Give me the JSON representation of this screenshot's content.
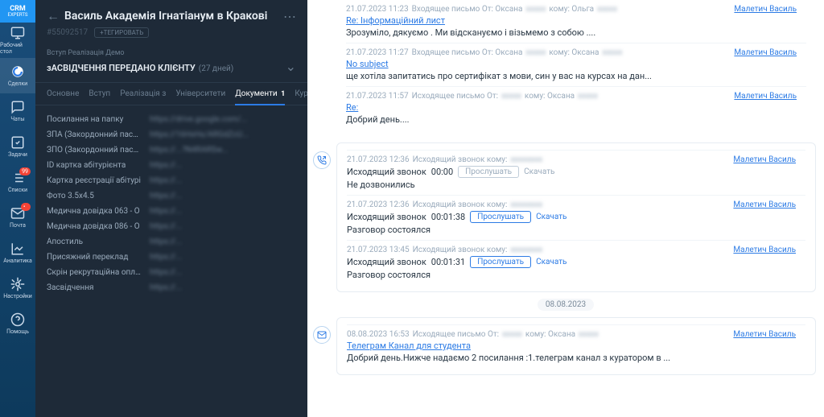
{
  "app": {
    "logo_line1": "CRM",
    "logo_line2": "EXPERTS"
  },
  "nav": [
    {
      "icon": "desktop",
      "label": "Рабочий стол"
    },
    {
      "icon": "swirl",
      "label": "Сделки",
      "active": true
    },
    {
      "icon": "chat",
      "label": "Чаты"
    },
    {
      "icon": "check",
      "label": "Задачи"
    },
    {
      "icon": "list",
      "label": "Списки",
      "badge": "99"
    },
    {
      "icon": "mail",
      "label": "Почта",
      "badge": "•"
    },
    {
      "icon": "analytics",
      "label": "Аналитика"
    },
    {
      "icon": "gear",
      "label": "Настройки"
    },
    {
      "icon": "help",
      "label": "Помощь"
    }
  ],
  "deal": {
    "title": "Василь Академія Ігнатіанум в Кракові",
    "id": "#55092517",
    "tag_btn": "+ТЕГИРОВАТЬ",
    "stage_pre": "Вступ Реалізація Демо",
    "stage_name": "зАСВІДЧЕННЯ ПЕРЕДАНО КЛІЄНТУ",
    "stage_days": "(27 дней)"
  },
  "tabs": [
    {
      "label": "Основне"
    },
    {
      "label": "Вступ"
    },
    {
      "label": "Реалізація з"
    },
    {
      "label": "Університети"
    },
    {
      "label": "Документи",
      "count": "1",
      "active": true
    },
    {
      "label": "Кур"
    }
  ],
  "docs": [
    {
      "label": "Посилання на папку",
      "value": "https://drive.google.com/..."
    },
    {
      "label": "ЗПА (Закордонний паспо",
      "value": "https://16HxHs/ARGdZcU..."
    },
    {
      "label": "ЗПО (Закордонний паспо",
      "value": "https://...?N4RARSw..."
    },
    {
      "label": "ID картка абітурієнта",
      "value": "https://..."
    },
    {
      "label": "Картка реєстрації абітурі",
      "value": "https://..."
    },
    {
      "label": "Фото 3.5х4.5",
      "value": "https://..."
    },
    {
      "label": "Медична довідка 063 - О",
      "value": "https://..."
    },
    {
      "label": "Медична довідка 086 - О",
      "value": "https://..."
    },
    {
      "label": "Апостиль",
      "value": "https://..."
    },
    {
      "label": "Присяжний переклад",
      "value": "https://..."
    },
    {
      "label": "Скрін рекрутаційна оплат",
      "value": "https://..."
    },
    {
      "label": "Засвідчення",
      "value": "https://..."
    }
  ],
  "feed": {
    "author": "Малетич Василь",
    "emails1": [
      {
        "time": "21.07.2023 11:23",
        "dir": "Входящее письмо От: Оксана",
        "to": "кому: Ольга",
        "subject": "Re: Інформаційний лист",
        "preview": "Зрозуміло, дякуємо . Ми відскануємо і візьмемо з собою ...."
      },
      {
        "time": "21.07.2023 11:27",
        "dir": "Входящее письмо От: Оксана",
        "to": "кому: Оксана",
        "subject": "No subject",
        "preview": "ще хотіла запитатись про сертифікат з мови, син у вас на курсах на дан..."
      },
      {
        "time": "21.07.2023 11:57",
        "dir": "Исходящее письмо От:",
        "to": "кому: Оксана",
        "subject": "Re:",
        "preview": "Добрий день...."
      }
    ],
    "calls": [
      {
        "time": "21.07.2023 12:36",
        "dir": "Исходящий звонок кому:",
        "line": "Исходящий звонок",
        "duration": "00:00",
        "status": "Не дозвонились",
        "listen": "Прослушать",
        "download": "Скачать",
        "muted": true
      },
      {
        "time": "21.07.2023 12:36",
        "dir": "Исходящий звонок кому:",
        "line": "Исходящий звонок",
        "duration": "00:01:38",
        "status": "Разговор состоялся",
        "listen": "Прослушать",
        "download": "Скачать"
      },
      {
        "time": "21.07.2023 13:45",
        "dir": "Исходящий звонок кому:",
        "line": "Исходящий звонок",
        "duration": "00:01:31",
        "status": "Разговор состоялся",
        "listen": "Прослушать",
        "download": "Скачать"
      }
    ],
    "date_chip": "08.08.2023",
    "emails2": [
      {
        "time": "08.08.2023 16:53",
        "dir": "Исходящее письмо От:",
        "to": "кому: Оксана",
        "subject": "Телеграм Канал для студента",
        "preview": "Добрий день.Нижче надаємо 2 посилання :1.телеграм канал з куратором в ..."
      }
    ]
  }
}
